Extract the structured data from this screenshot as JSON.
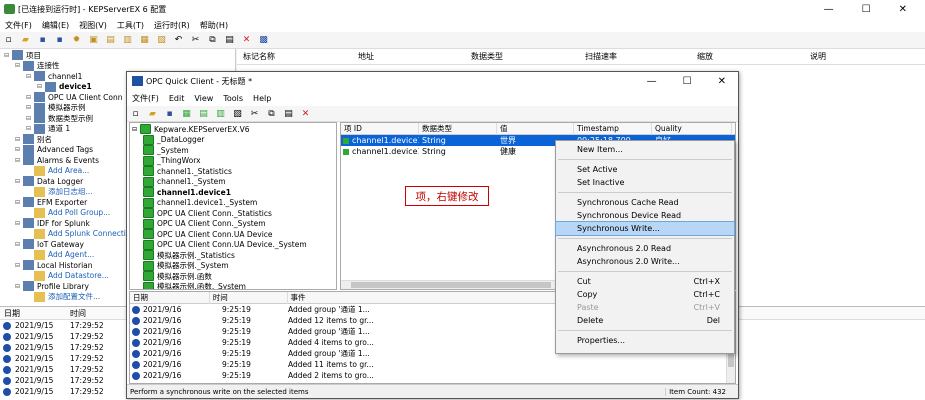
{
  "main": {
    "title": "[已连接到运行时] - KEPServerEX 6 配置",
    "menu": [
      "文件(F)",
      "编辑(E)",
      "视图(V)",
      "工具(T)",
      "运行时(R)",
      "帮助(H)"
    ],
    "right_headers": [
      "标记名称",
      "地址",
      "数据类型",
      "扫描速率",
      "缩放",
      "说明"
    ],
    "tree": [
      {
        "label": "项目",
        "indent": 0
      },
      {
        "label": "连接性",
        "indent": 1
      },
      {
        "label": "channel1",
        "indent": 2
      },
      {
        "label": "device1",
        "indent": 3,
        "bold": true
      },
      {
        "label": "OPC UA Client Conn",
        "indent": 2
      },
      {
        "label": "模拟器示例",
        "indent": 2
      },
      {
        "label": "数据类型示例",
        "indent": 2
      },
      {
        "label": "通道 1",
        "indent": 2
      },
      {
        "label": "别名",
        "indent": 1
      },
      {
        "label": "Advanced Tags",
        "indent": 1
      },
      {
        "label": "Alarms & Events",
        "indent": 1
      },
      {
        "label": "Add Area...",
        "indent": 2,
        "link": true
      },
      {
        "label": "Data Logger",
        "indent": 1
      },
      {
        "label": "添加日志组...",
        "indent": 2,
        "link": true
      },
      {
        "label": "EFM Exporter",
        "indent": 1
      },
      {
        "label": "Add Poll Group...",
        "indent": 2,
        "link": true
      },
      {
        "label": "IDF for Splunk",
        "indent": 1
      },
      {
        "label": "Add Splunk Connection",
        "indent": 2,
        "link": true
      },
      {
        "label": "IoT Gateway",
        "indent": 1
      },
      {
        "label": "Add Agent...",
        "indent": 2,
        "link": true
      },
      {
        "label": "Local Historian",
        "indent": 1
      },
      {
        "label": "Add Datastore...",
        "indent": 2,
        "link": true
      },
      {
        "label": "Profile Library",
        "indent": 1
      },
      {
        "label": "添加配置文件...",
        "indent": 2,
        "link": true
      }
    ],
    "log_headers": [
      "日期",
      "时间"
    ],
    "log_rows": [
      {
        "date": "2021/9/15",
        "time": "17:29:52"
      },
      {
        "date": "2021/9/15",
        "time": "17:29:52"
      },
      {
        "date": "2021/9/15",
        "time": "17:29:52"
      },
      {
        "date": "2021/9/15",
        "time": "17:29:52"
      },
      {
        "date": "2021/9/15",
        "time": "17:29:52"
      },
      {
        "date": "2021/9/15",
        "time": "17:29:52"
      },
      {
        "date": "2021/9/15",
        "time": "17:29:52"
      }
    ]
  },
  "opc": {
    "title": "OPC Quick Client - 无标题 *",
    "menu": [
      "文件(F)",
      "Edit",
      "View",
      "Tools",
      "Help"
    ],
    "tree": [
      {
        "label": "Kepware.KEPServerEX.V6",
        "indent": 0
      },
      {
        "label": "_DataLogger",
        "indent": 1
      },
      {
        "label": "_System",
        "indent": 1
      },
      {
        "label": "_ThingWorx",
        "indent": 1
      },
      {
        "label": "channel1._Statistics",
        "indent": 1
      },
      {
        "label": "channel1._System",
        "indent": 1
      },
      {
        "label": "channel1.device1",
        "indent": 1,
        "bold": true
      },
      {
        "label": "channel1.device1._System",
        "indent": 1
      },
      {
        "label": "OPC UA Client Conn._Statistics",
        "indent": 1
      },
      {
        "label": "OPC UA Client Conn._System",
        "indent": 1
      },
      {
        "label": "OPC UA Client Conn.UA Device",
        "indent": 1
      },
      {
        "label": "OPC UA Client Conn.UA Device._System",
        "indent": 1
      },
      {
        "label": "模拟器示例._Statistics",
        "indent": 1
      },
      {
        "label": "模拟器示例._System",
        "indent": 1
      },
      {
        "label": "模拟器示例.函数",
        "indent": 1
      },
      {
        "label": "模拟器示例.函数._System",
        "indent": 1
      }
    ],
    "item_headers": [
      "项 ID",
      "数据类型",
      "值",
      "Timestamp",
      "Quality"
    ],
    "items": [
      {
        "id": "channel1.device1.t...",
        "type": "String",
        "value": "世界",
        "ts": "09:25:18.700",
        "quality": "良好",
        "selected": true
      },
      {
        "id": "channel1.device1.t...",
        "type": "String",
        "value": "健康",
        "ts": "",
        "quality": "",
        "selected": false
      }
    ],
    "log_headers": [
      "日期",
      "时间",
      "事件"
    ],
    "log_rows": [
      {
        "date": "2021/9/16",
        "time": "9:25:19",
        "event": "Added group '通道 1..."
      },
      {
        "date": "2021/9/16",
        "time": "9:25:19",
        "event": "Added 12 items to gr..."
      },
      {
        "date": "2021/9/16",
        "time": "9:25:19",
        "event": "Added group '通道 1..."
      },
      {
        "date": "2021/9/16",
        "time": "9:25:19",
        "event": "Added 4 items to gro..."
      },
      {
        "date": "2021/9/16",
        "time": "9:25:19",
        "event": "Added group '通道 1..."
      },
      {
        "date": "2021/9/16",
        "time": "9:25:19",
        "event": "Added 11 items to gr..."
      },
      {
        "date": "2021/9/16",
        "time": "9:25:19",
        "event": "Added 2 items to gro..."
      }
    ],
    "status_text": "Perform a synchronous write on the selected items",
    "item_count": "Item Count: 432"
  },
  "context_menu": [
    {
      "label": "New Item...",
      "shortcut": ""
    },
    {
      "sep": true
    },
    {
      "label": "Set Active",
      "shortcut": ""
    },
    {
      "label": "Set Inactive",
      "shortcut": ""
    },
    {
      "sep": true
    },
    {
      "label": "Synchronous Cache Read",
      "shortcut": ""
    },
    {
      "label": "Synchronous Device Read",
      "shortcut": ""
    },
    {
      "label": "Synchronous Write...",
      "shortcut": "",
      "highlight": true
    },
    {
      "sep": true
    },
    {
      "label": "Asynchronous 2.0 Read",
      "shortcut": ""
    },
    {
      "label": "Asynchronous 2.0 Write...",
      "shortcut": ""
    },
    {
      "sep": true
    },
    {
      "label": "Cut",
      "shortcut": "Ctrl+X"
    },
    {
      "label": "Copy",
      "shortcut": "Ctrl+C"
    },
    {
      "label": "Paste",
      "shortcut": "Ctrl+V",
      "disabled": true
    },
    {
      "label": "Delete",
      "shortcut": "Del"
    },
    {
      "sep": true
    },
    {
      "label": "Properties...",
      "shortcut": ""
    }
  ],
  "annotation": "项，右键修改",
  "colors": {
    "accent": "#1c5fb8",
    "folder": "#2fa836",
    "annotation": "#c00000",
    "highlight": "#b8d6f5"
  }
}
